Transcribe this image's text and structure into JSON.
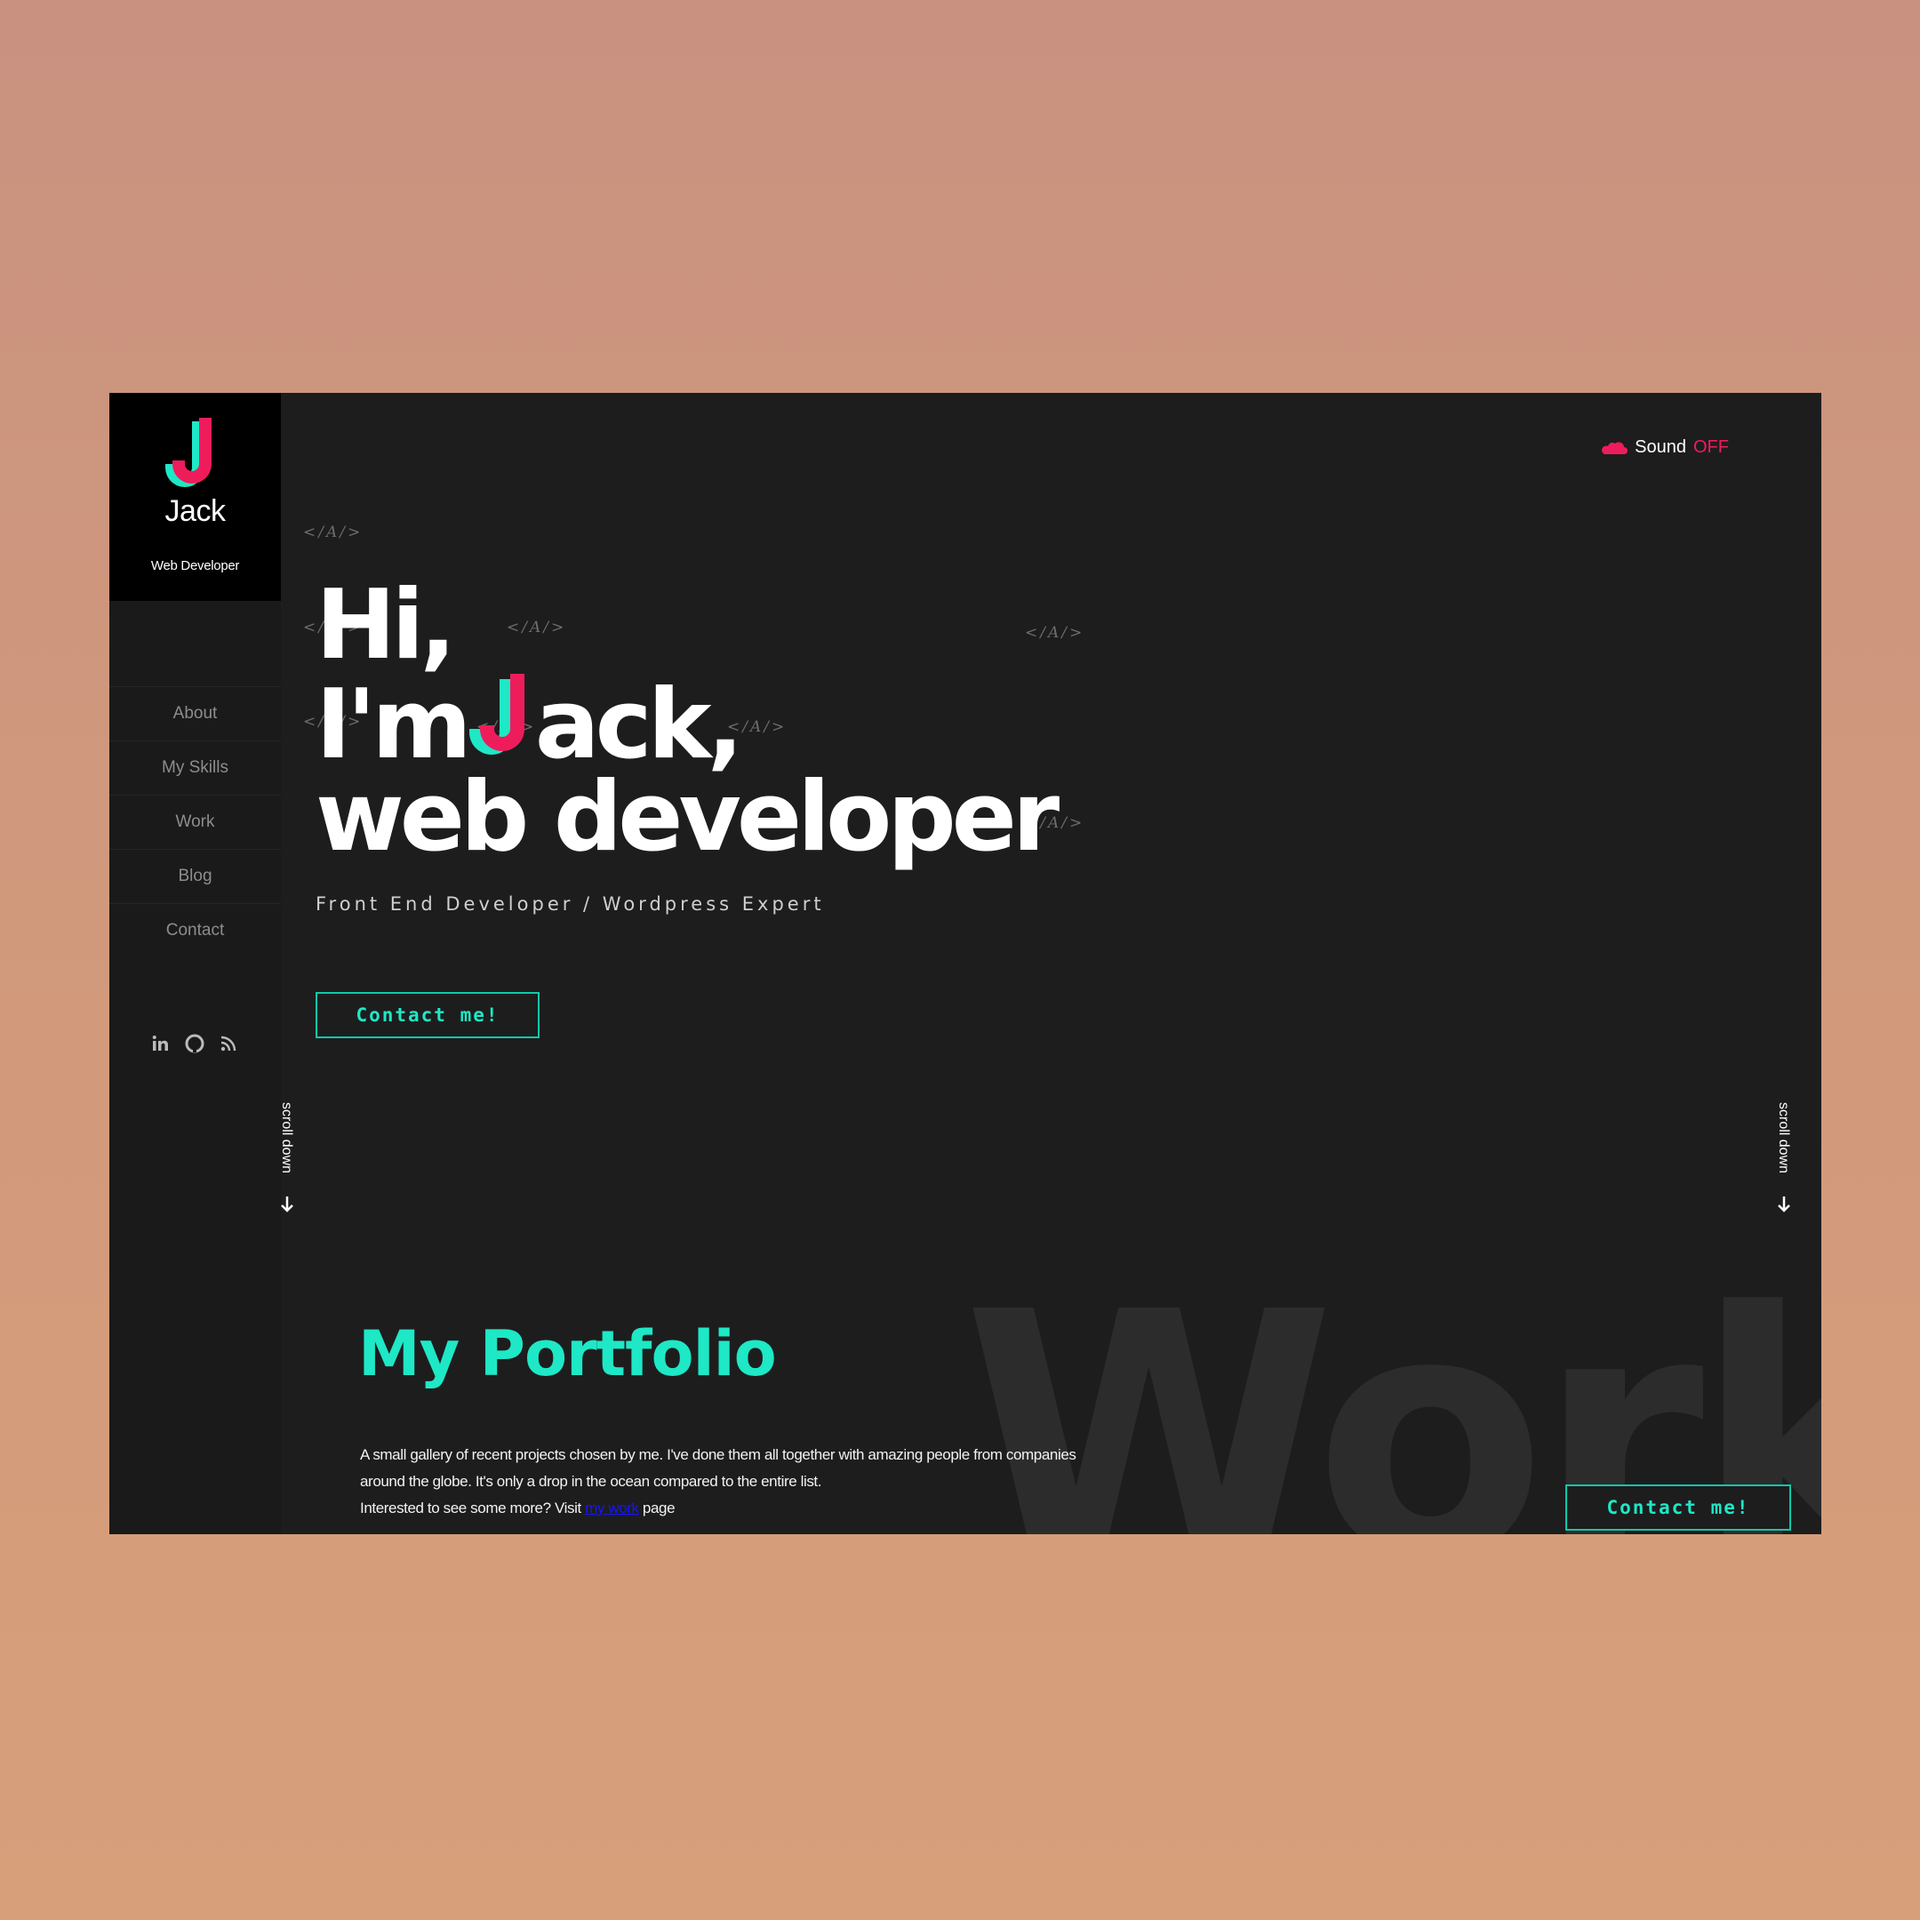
{
  "brand": {
    "name": "Jack",
    "role": "Web Developer"
  },
  "nav": [
    {
      "label": "About"
    },
    {
      "label": "My Skills"
    },
    {
      "label": "Work"
    },
    {
      "label": "Blog"
    },
    {
      "label": "Contact"
    }
  ],
  "social": [
    "linkedin-icon",
    "github-icon",
    "rss-icon"
  ],
  "sound": {
    "label": "Sound",
    "state": "OFF"
  },
  "code_tag": "</A/>",
  "hero": {
    "line1": "Hi,",
    "line2_pre": "I'm",
    "line2_post": "ack,",
    "line3": "web developer",
    "subtitle": "Front End Developer / Wordpress Expert"
  },
  "cta": {
    "label": "Contact me!"
  },
  "scroll": {
    "label": "scroll down"
  },
  "portfolio": {
    "bg_word": "Work",
    "title": "My Portfolio",
    "line1": "A small gallery of recent projects chosen by me. I've done them all together with amazing people from companies",
    "line2": "around the globe. It's only a drop in the ocean compared to the entire list.",
    "line3_pre": "Interested to see some more? Visit",
    "link": "my work",
    "line3_post": "page"
  },
  "colors": {
    "accent": "#1ee8c6",
    "pink": "#ef1c5c",
    "background": "#1d1d1e"
  }
}
